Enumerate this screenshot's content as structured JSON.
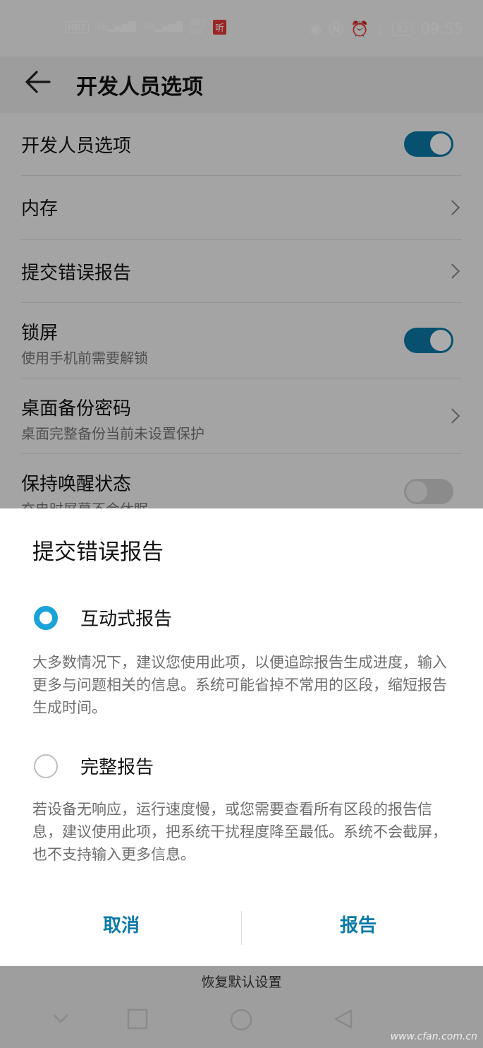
{
  "status_bar": {
    "hd": "HD",
    "hd_sim": "1",
    "signal1": "46",
    "signal2": "46",
    "speed_value": "885",
    "speed_unit": "B/s",
    "app_badge": "听",
    "battery": "82",
    "time": "09:55",
    "icons": [
      "eye-icon",
      "nfc-icon",
      "alarm-icon",
      "bluetooth-icon"
    ]
  },
  "app_bar": {
    "title": "开发人员选项"
  },
  "settings": {
    "dev_options": {
      "label": "开发人员选项",
      "on": true
    },
    "memory": {
      "label": "内存"
    },
    "bug_report": {
      "label": "提交错误报告"
    },
    "lock_screen": {
      "label": "锁屏",
      "sub": "使用手机前需要解锁",
      "on": true
    },
    "backup_pwd": {
      "label": "桌面备份密码",
      "sub": "桌面完整备份当前未设置保护"
    },
    "stay_awake": {
      "label": "保持唤醒状态",
      "sub": "充电时屏幕不会休眠",
      "on": false
    }
  },
  "dialog": {
    "title": "提交错误报告",
    "options": [
      {
        "label": "互动式报告",
        "selected": true,
        "desc": "大多数情况下，建议您使用此项，以便追踪报告生成进度，输入更多与问题相关的信息。系统可能省掉不常用的区段，缩短报告生成时间。"
      },
      {
        "label": "完整报告",
        "selected": false,
        "desc": "若设备无响应，运行速度慢，或您需要查看所有区段的报告信息，建议使用此项，把系统干扰程度降至最低。系统不会截屏，也不支持输入更多信息。"
      }
    ],
    "cancel": "取消",
    "confirm": "报告"
  },
  "footer": {
    "restore_defaults": "恢复默认设置"
  },
  "watermark": "www.cfan.com.cn",
  "colors": {
    "accent": "#1aa3d8",
    "button_text": "#0b7aa8",
    "toggle_on": "#0b78a8"
  }
}
